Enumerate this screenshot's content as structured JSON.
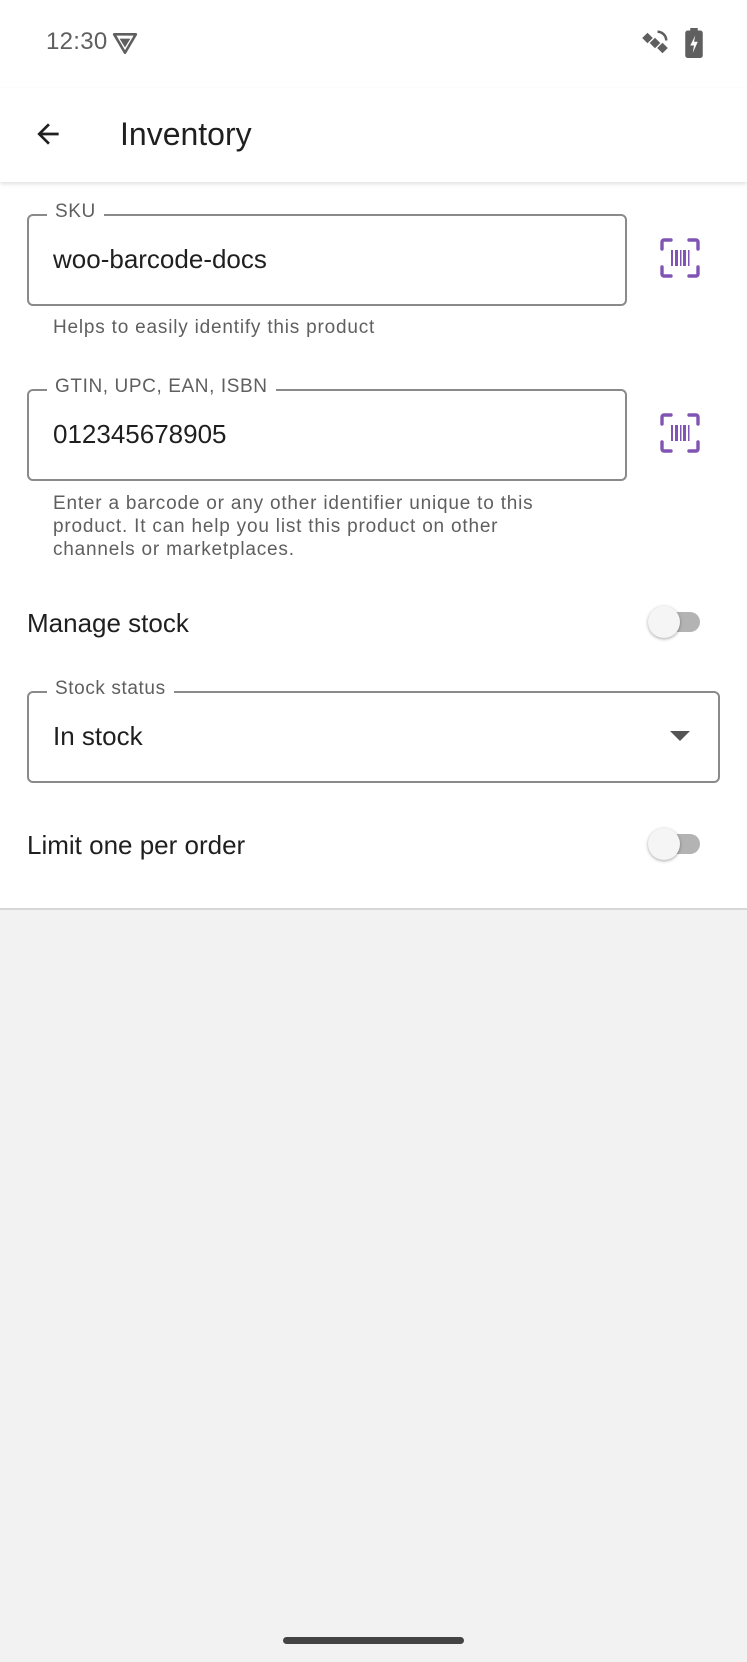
{
  "status_bar": {
    "time": "12:30",
    "icons": [
      "vpn-icon",
      "satellite-icon",
      "battery-charging-icon"
    ]
  },
  "app_bar": {
    "back_icon": "arrow-back-icon",
    "title": "Inventory"
  },
  "form": {
    "sku": {
      "label": "SKU",
      "value": "woo-barcode-docs",
      "helper": "Helps to easily identify this product",
      "scan_icon": "barcode-scan-icon"
    },
    "gtin": {
      "label": "GTIN, UPC, EAN, ISBN",
      "value": "012345678905",
      "helper": "Enter a barcode or any other identifier unique to this product. It can help you list this product on other channels or marketplaces.",
      "scan_icon": "barcode-scan-icon"
    },
    "manage_stock": {
      "label": "Manage stock",
      "enabled": false
    },
    "stock_status": {
      "label": "Stock status",
      "selected": "In stock"
    },
    "limit_one": {
      "label": "Limit one per order",
      "enabled": false
    }
  },
  "colors": {
    "accent": "#7f54b3",
    "text": "#1f1f1f",
    "secondary_text": "#5f5f5f",
    "background": "#f2f2f2"
  }
}
